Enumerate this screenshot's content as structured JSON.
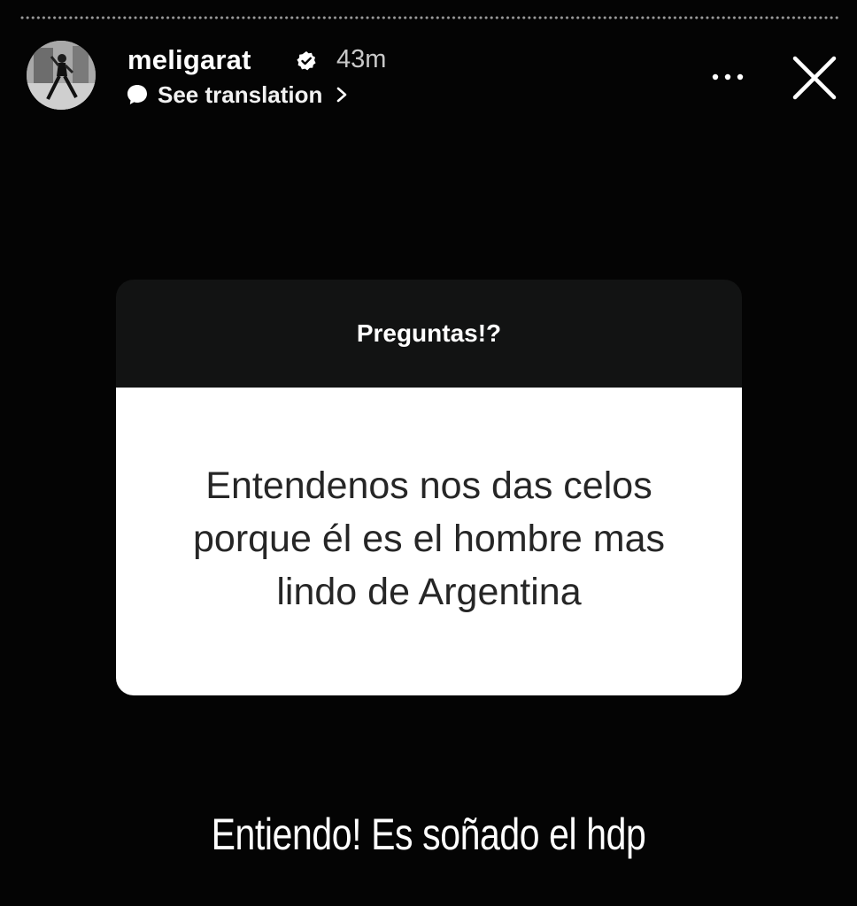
{
  "story": {
    "progress_segments": 1
  },
  "header": {
    "username": "meligarat",
    "timestamp": "43m",
    "translation_label": "See translation",
    "verified_icon": "verified-badge-icon",
    "more_icon": "more-options-icon",
    "close_icon": "close-icon"
  },
  "question_sticker": {
    "title": "Preguntas!?",
    "question": "Entendenos nos das celos porque él es el hombre mas lindo de Argentina"
  },
  "caption": "Entiendo! Es soñado el hdp",
  "colors": {
    "background": "#040404",
    "card_header": "#121313",
    "card_body": "#ffffff",
    "question_text": "#262626",
    "timestamp": "#c9c9c9"
  }
}
